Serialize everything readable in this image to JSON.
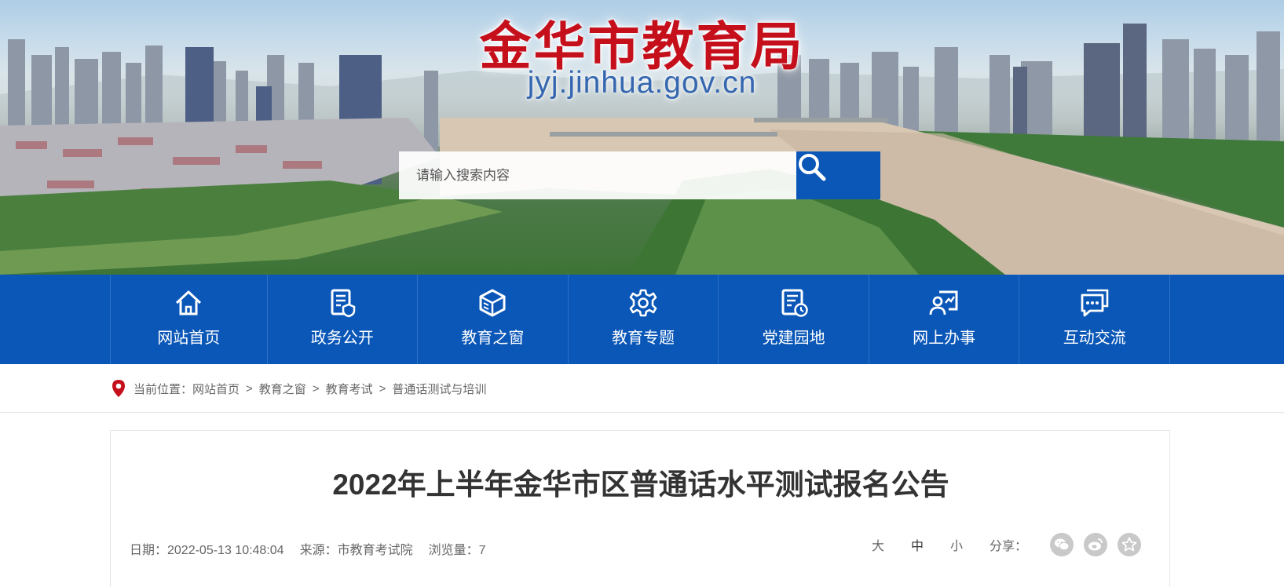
{
  "header": {
    "site_title": "金华市教育局",
    "site_domain": "jyj.jinhua.gov.cn",
    "search": {
      "placeholder": "请输入搜索内容",
      "button_icon": "search-icon"
    }
  },
  "nav": {
    "items": [
      {
        "label": "网站首页",
        "icon": "home-icon"
      },
      {
        "label": "政务公开",
        "icon": "document-shield-icon"
      },
      {
        "label": "教育之窗",
        "icon": "cube-icon"
      },
      {
        "label": "教育专题",
        "icon": "gear-icon"
      },
      {
        "label": "党建园地",
        "icon": "document-clock-icon"
      },
      {
        "label": "网上办事",
        "icon": "person-chart-icon"
      },
      {
        "label": "互动交流",
        "icon": "chat-bubble-icon"
      }
    ]
  },
  "breadcrumb": {
    "prefix": "当前位置：",
    "items": [
      "网站首页",
      "教育之窗",
      "教育考试",
      "普通话测试与培训"
    ],
    "separator": ">"
  },
  "article": {
    "title": "2022年上半年金华市区普通话水平测试报名公告",
    "date": "日期：2022-05-13 10:48:04",
    "source": "来源：市教育考试院",
    "views": "浏览量：7"
  },
  "tools": {
    "sizes": [
      "大",
      "中",
      "小"
    ],
    "active_size": "中",
    "share_label": "分享：",
    "share_icons": [
      "wechat-icon",
      "weibo-icon",
      "favorite-star-icon"
    ]
  },
  "colors": {
    "brand_blue": "#0a57b8",
    "title_red": "#c5101c",
    "domain_blue": "#3567b0"
  }
}
